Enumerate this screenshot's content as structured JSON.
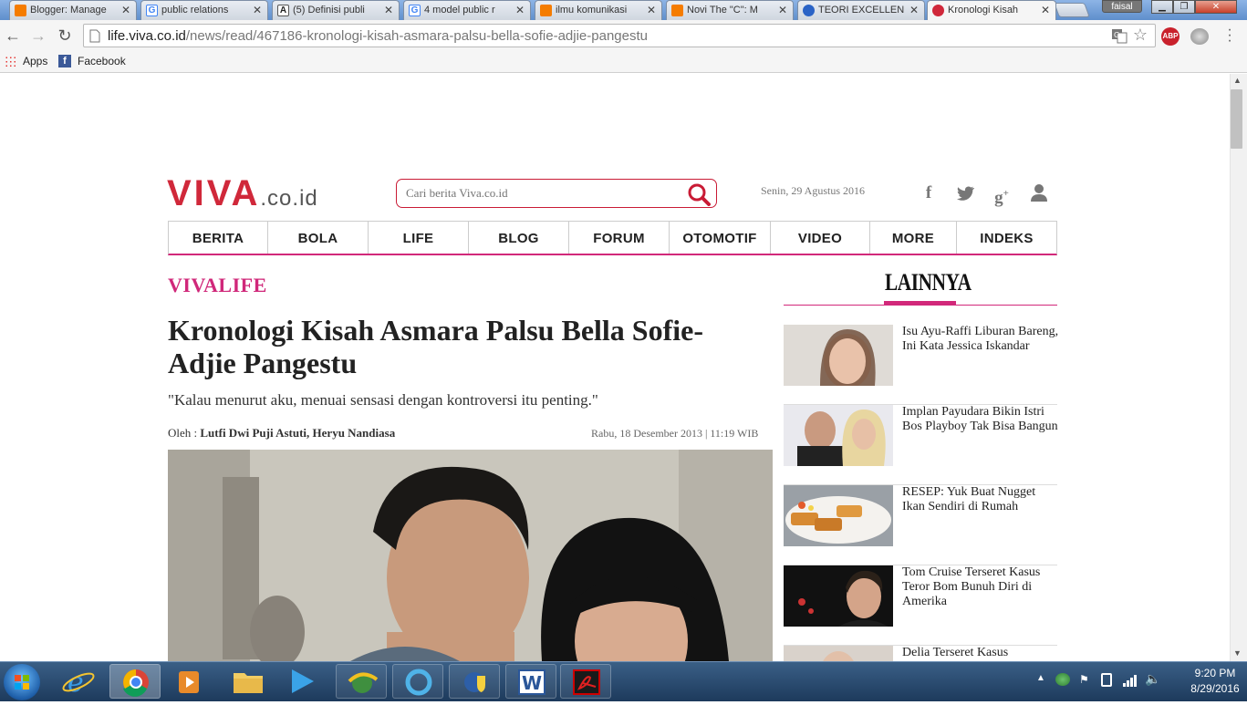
{
  "browser": {
    "tabs": [
      {
        "title": "Blogger: Manage",
        "favicon_color": "#f57c00"
      },
      {
        "title": "public relations",
        "favicon_color": "#4285f4"
      },
      {
        "title": "(5) Definisi publi",
        "favicon_color": "#555555"
      },
      {
        "title": "4 model public r",
        "favicon_color": "#4285f4"
      },
      {
        "title": "ilmu komunikasi",
        "favicon_color": "#f57c00"
      },
      {
        "title": "Novi The \"C\": M",
        "favicon_color": "#f57c00"
      },
      {
        "title": "TEORI EXCELLEN",
        "favicon_color": "#2a63c6"
      },
      {
        "title": "Kronologi Kisah",
        "favicon_color": "#d0283a"
      }
    ],
    "profile_name": "faisal",
    "url_host": "life.viva.co.id",
    "url_path": "/news/read/467186-kronologi-kisah-asmara-palsu-bella-sofie-adjie-pangestu",
    "bookmarks": {
      "apps_label": "Apps",
      "facebook_label": "Facebook"
    },
    "extension_badge": "ABP"
  },
  "site": {
    "logo_main": "VIVA",
    "logo_domain": ".co.id",
    "search_placeholder": "Cari berita Viva.co.id",
    "date": "Senin, 29 Agustus 2016",
    "social_icons": [
      "facebook-icon",
      "twitter-icon",
      "google-plus-icon",
      "user-icon"
    ],
    "nav": [
      "BERITA",
      "BOLA",
      "LIFE",
      "BLOG",
      "FORUM",
      "OTOMOTIF",
      "VIDEO",
      "MORE",
      "INDEKS"
    ],
    "accent_color": "#d0283a",
    "pink_color": "#d2287a"
  },
  "article": {
    "section": "VIVALIFE",
    "headline": "Kronologi Kisah Asmara Palsu Bella Sofie-Adjie Pangestu",
    "quote": "\"Kalau menurut aku, menuai sensasi dengan kontroversi itu penting.\"",
    "by_label": "Oleh :",
    "authors": "Lutfi Dwi Puji Astuti, Heryu Nandiasa",
    "published": "Rabu, 18 Desember 2013 | 11:19 WIB"
  },
  "sidebar": {
    "heading": "LAINNYA",
    "items": [
      {
        "title": "Isu Ayu-Raffi Liburan Bareng, Ini Kata Jessica Iskandar"
      },
      {
        "title": "Implan Payudara Bikin Istri Bos Playboy Tak Bisa Bangun"
      },
      {
        "title": "RESEP: Yuk Buat Nugget Ikan Sendiri di Rumah"
      },
      {
        "title": "Tom Cruise Terseret Kasus Teror Bom Bunuh Diri di Amerika"
      },
      {
        "title": "Delia Terseret Kasus"
      }
    ]
  },
  "taskbar": {
    "time": "9:20 PM",
    "date": "8/29/2016"
  }
}
